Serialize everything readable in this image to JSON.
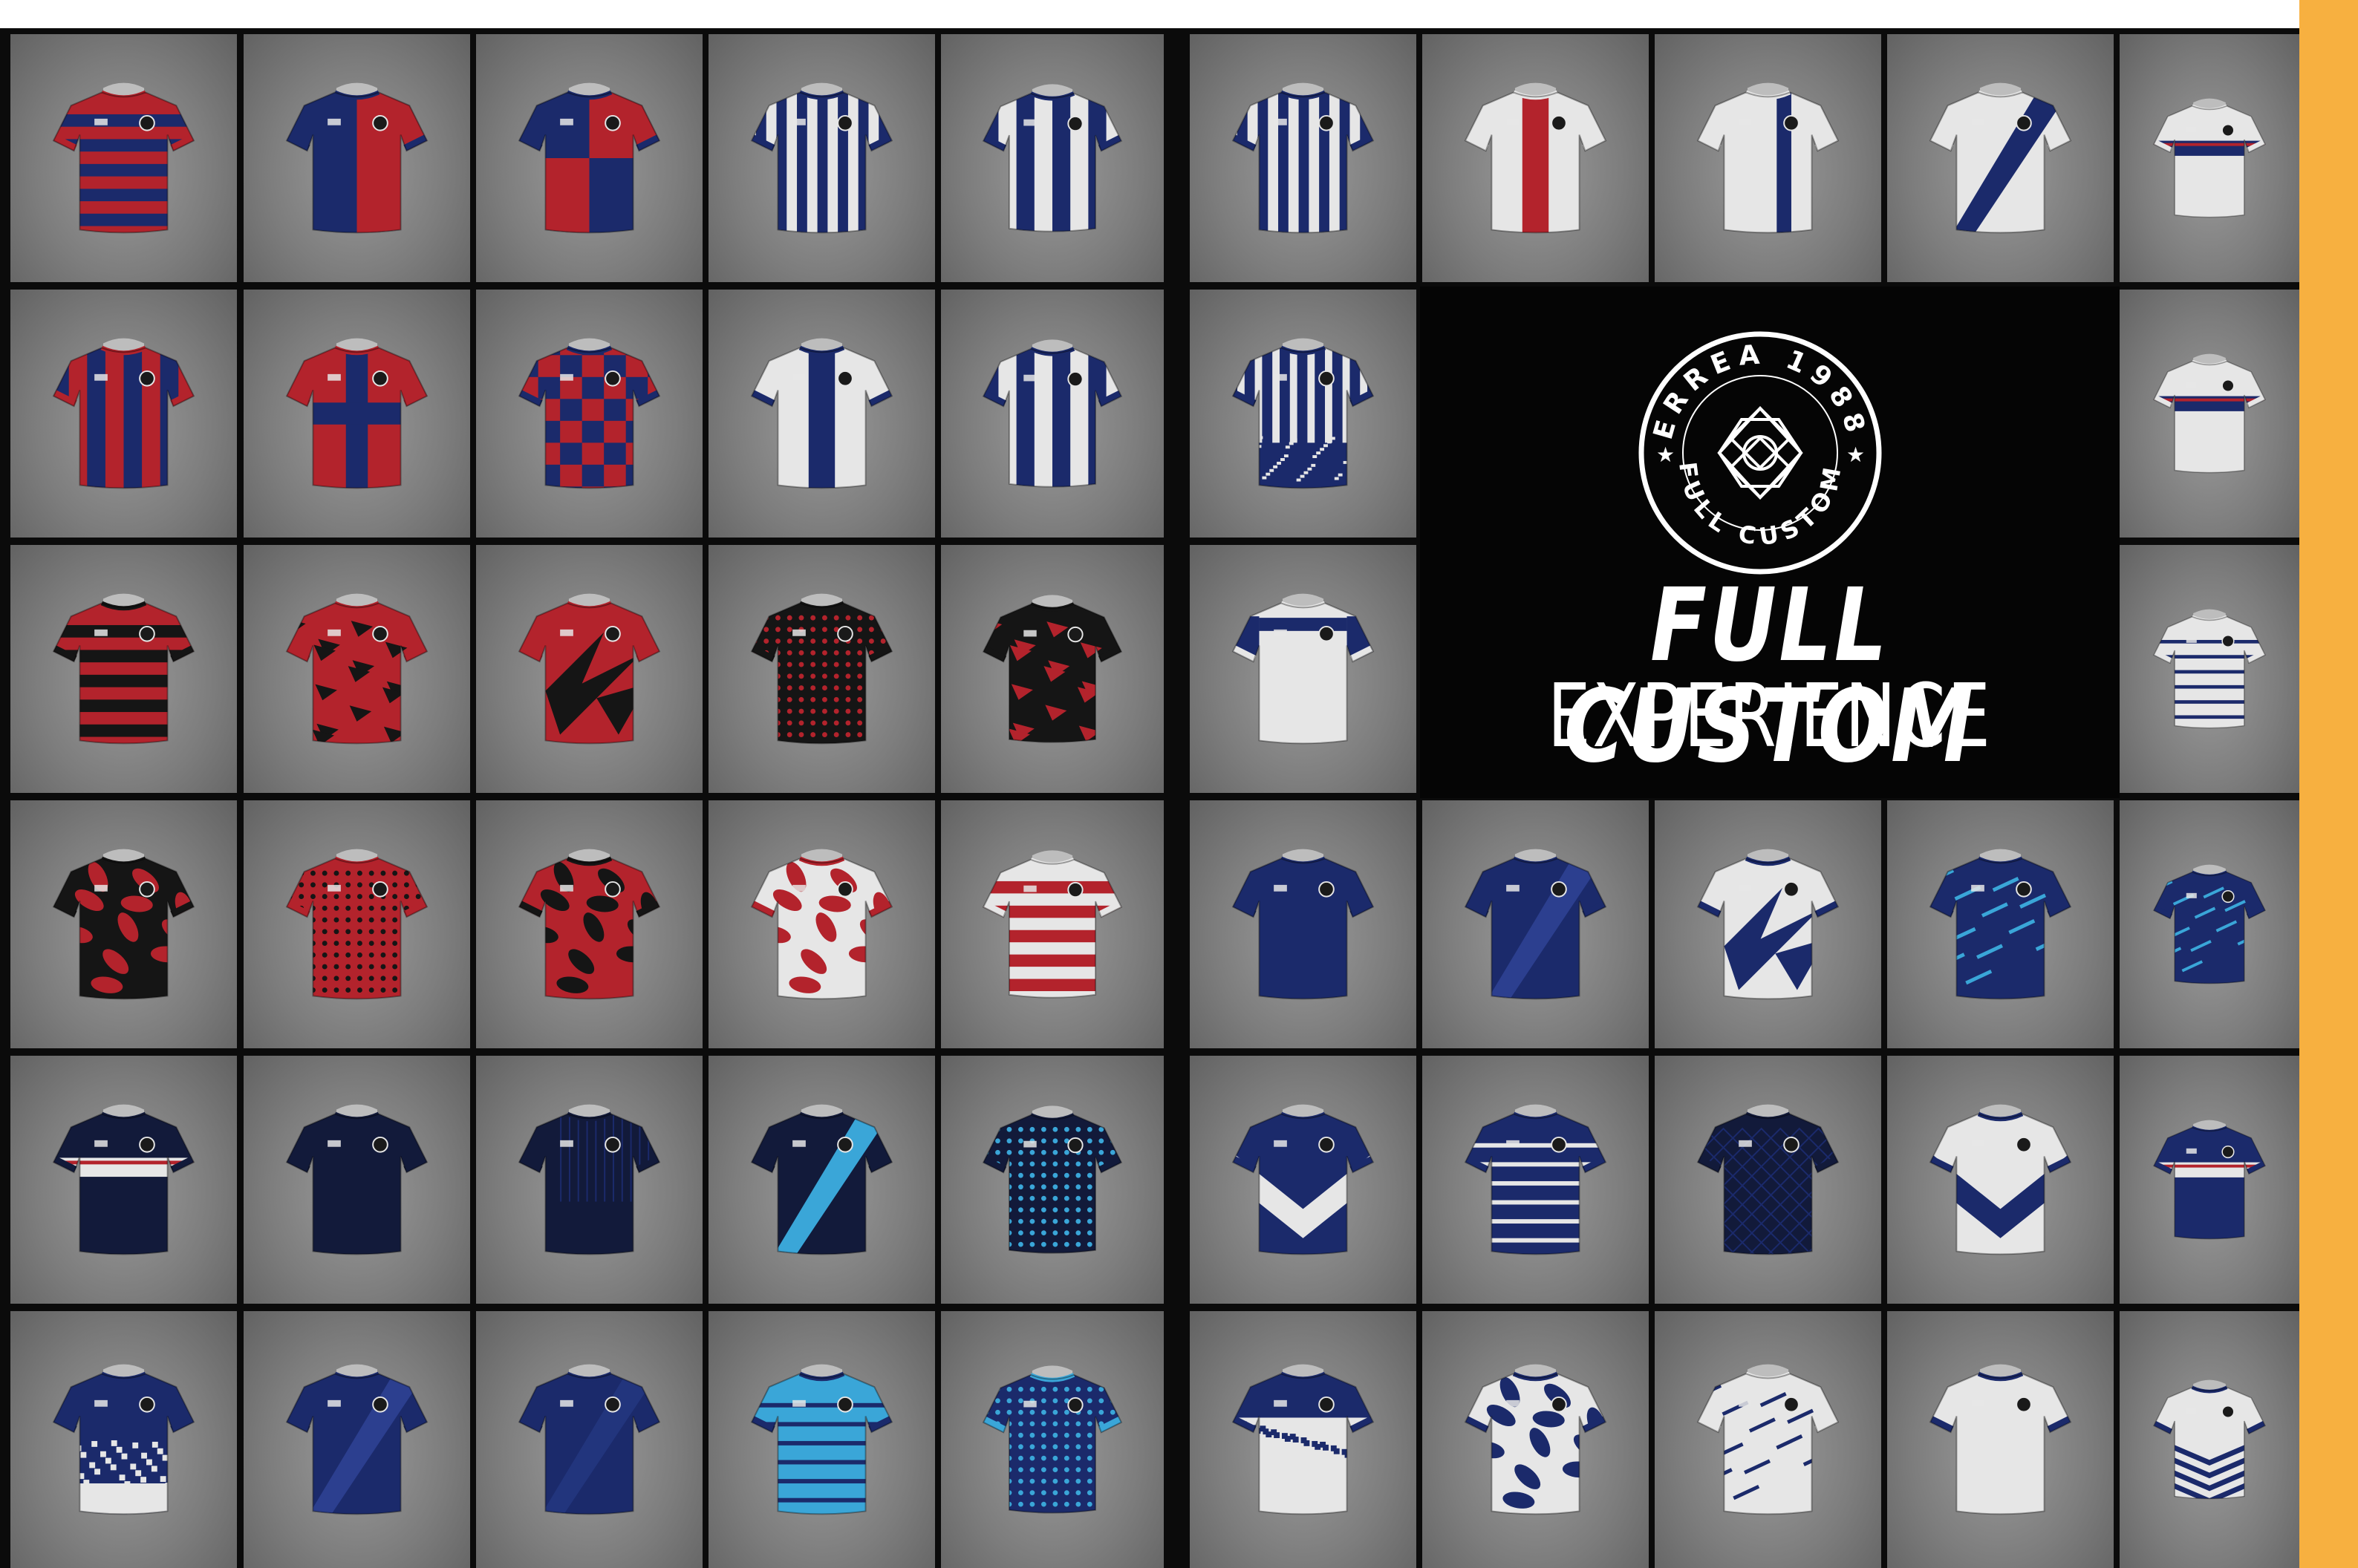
{
  "brand": {
    "seal_text_top": "ERREA 1988",
    "seal_text_bottom": "FULL CUSTOM",
    "headline": "FULL CUSTOM",
    "subheadline": "EXPERIENCE"
  },
  "colors": {
    "accent_bar": "#f7b040",
    "background": "#0b0b0b",
    "red": "#b3232c",
    "navy": "#1b2a6b",
    "white": "#e6e6e6",
    "black": "#151515",
    "cyan": "#3aa6d8"
  },
  "jerseys": [
    {
      "style": "hoops",
      "c1": "#b3232c",
      "c2": "#1b2a6b",
      "c3": "#b3232c"
    },
    {
      "style": "halves",
      "c1": "#1b2a6b",
      "c2": "#b3232c",
      "c3": "#1b2a6b"
    },
    {
      "style": "quarters",
      "c1": "#1b2a6b",
      "c2": "#b3232c",
      "c3": "#1b2a6b"
    },
    {
      "style": "vstripes",
      "c1": "#e6e6e6",
      "c2": "#1b2a6b",
      "c3": "#1b2a6b"
    },
    {
      "style": "vstripes-wide",
      "c1": "#e6e6e6",
      "c2": "#1b2a6b",
      "c3": "#1b2a6b"
    },
    {
      "style": "vstripes",
      "c1": "#e6e6e6",
      "c2": "#1b2a6b",
      "c3": "#1b2a6b"
    },
    {
      "style": "center-stripe",
      "c1": "#e6e6e6",
      "c2": "#b3232c",
      "c3": "#e6e6e6"
    },
    {
      "style": "offset-stripe",
      "c1": "#e6e6e6",
      "c2": "#1b2a6b",
      "c3": "#e6e6e6"
    },
    {
      "style": "sash",
      "c1": "#e6e6e6",
      "c2": "#1b2a6b",
      "c3": "#e6e6e6"
    },
    {
      "style": "chest-band",
      "c1": "#e6e6e6",
      "c2": "#1b2a6b",
      "c3": "#e6e6e6"
    },
    {
      "style": "vstripes-wide",
      "c1": "#b3232c",
      "c2": "#1b2a6b",
      "c3": "#b3232c"
    },
    {
      "style": "cross",
      "c1": "#b3232c",
      "c2": "#1b2a6b",
      "c3": "#b3232c"
    },
    {
      "style": "checks",
      "c1": "#1b2a6b",
      "c2": "#b3232c",
      "c3": "#1b2a6b"
    },
    {
      "style": "center-stripe",
      "c1": "#e6e6e6",
      "c2": "#1b2a6b",
      "c3": "#1b2a6b"
    },
    {
      "style": "vstripes-wide",
      "c1": "#e6e6e6",
      "c2": "#1b2a6b",
      "c3": "#1b2a6b"
    },
    {
      "style": "vstripes-fade",
      "c1": "#1b2a6b",
      "c2": "#e6e6e6",
      "c3": "#1b2a6b"
    },
    {
      "style": "chest-band",
      "c1": "#e6e6e6",
      "c2": "#1b2a6b",
      "c3": "#e6e6e6"
    },
    {
      "style": "hoops",
      "c1": "#b3232c",
      "c2": "#151515",
      "c3": "#151515"
    },
    {
      "style": "splatter",
      "c1": "#b3232c",
      "c2": "#151515",
      "c3": "#b3232c"
    },
    {
      "style": "shards",
      "c1": "#b3232c",
      "c2": "#151515",
      "c3": "#b3232c"
    },
    {
      "style": "dots",
      "c1": "#151515",
      "c2": "#b3232c",
      "c3": "#151515"
    },
    {
      "style": "brush",
      "c1": "#151515",
      "c2": "#b3232c",
      "c3": "#151515"
    },
    {
      "style": "rugby-panel",
      "c1": "#e6e6e6",
      "c2": "#1b2a6b",
      "c3": "#e6e6e6"
    },
    {
      "style": "thin-hoops",
      "c1": "#e6e6e6",
      "c2": "#1b2a6b",
      "c3": "#e6e6e6"
    },
    {
      "style": "camo",
      "c1": "#151515",
      "c2": "#b3232c",
      "c3": "#151515"
    },
    {
      "style": "dots",
      "c1": "#b3232c",
      "c2": "#151515",
      "c3": "#b3232c"
    },
    {
      "style": "camo",
      "c1": "#b3232c",
      "c2": "#151515",
      "c3": "#151515"
    },
    {
      "style": "camo-light",
      "c1": "#e6e6e6",
      "c2": "#b3232c",
      "c3": "#b3232c"
    },
    {
      "style": "hoops",
      "c1": "#e6e6e6",
      "c2": "#b3232c",
      "c3": "#e6e6e6"
    },
    {
      "style": "plain",
      "c1": "#1b2a6b",
      "c2": "#2c3f8f",
      "c3": "#1b2a6b"
    },
    {
      "style": "sash",
      "c1": "#1b2a6b",
      "c2": "#2c3f8f",
      "c3": "#1b2a6b"
    },
    {
      "style": "shards",
      "c1": "#e6e6e6",
      "c2": "#1b2a6b",
      "c3": "#1b2a6b"
    },
    {
      "style": "streaks",
      "c1": "#1b2a6b",
      "c2": "#3aa6d8",
      "c3": "#1b2a6b"
    },
    {
      "style": "streaks",
      "c1": "#1b2a6b",
      "c2": "#3aa6d8",
      "c3": "#1b2a6b"
    },
    {
      "style": "chest-band",
      "c1": "#121a3a",
      "c2": "#e6e6e6",
      "c3": "#121a3a"
    },
    {
      "style": "plain",
      "c1": "#121a3a",
      "c2": "#1b2a6b",
      "c3": "#121a3a"
    },
    {
      "style": "pinstripes",
      "c1": "#121a3a",
      "c2": "#1b2a6b",
      "c3": "#121a3a"
    },
    {
      "style": "sash",
      "c1": "#121a3a",
      "c2": "#3aa6d8",
      "c3": "#121a3a"
    },
    {
      "style": "dots",
      "c1": "#121a3a",
      "c2": "#3aa6d8",
      "c3": "#121a3a"
    },
    {
      "style": "chevron",
      "c1": "#1b2a6b",
      "c2": "#e6e6e6",
      "c3": "#1b2a6b"
    },
    {
      "style": "thin-hoops",
      "c1": "#1b2a6b",
      "c2": "#e6e6e6",
      "c3": "#1b2a6b"
    },
    {
      "style": "diamonds",
      "c1": "#121a3a",
      "c2": "#1b2a6b",
      "c3": "#121a3a"
    },
    {
      "style": "chevron",
      "c1": "#e6e6e6",
      "c2": "#1b2a6b",
      "c3": "#1b2a6b"
    },
    {
      "style": "chest-band",
      "c1": "#1b2a6b",
      "c2": "#e6e6e6",
      "c3": "#1b2a6b"
    },
    {
      "style": "fade",
      "c1": "#1b2a6b",
      "c2": "#e6e6e6",
      "c3": "#1b2a6b"
    },
    {
      "style": "sash",
      "c1": "#1b2a6b",
      "c2": "#2c3f8f",
      "c3": "#1b2a6b"
    },
    {
      "style": "sash",
      "c1": "#1b2a6b",
      "c2": "#22357d",
      "c3": "#1b2a6b"
    },
    {
      "style": "thin-hoops",
      "c1": "#3aa6d8",
      "c2": "#1b2a6b",
      "c3": "#1b2a6b"
    },
    {
      "style": "dots",
      "c1": "#1b2a6b",
      "c2": "#3aa6d8",
      "c3": "#3aa6d8"
    },
    {
      "style": "fade-rev",
      "c1": "#e6e6e6",
      "c2": "#1b2a6b",
      "c3": "#1b2a6b"
    },
    {
      "style": "camo-light",
      "c1": "#e6e6e6",
      "c2": "#1b2a6b",
      "c3": "#1b2a6b"
    },
    {
      "style": "streaks",
      "c1": "#e6e6e6",
      "c2": "#1b2a6b",
      "c3": "#e6e6e6"
    },
    {
      "style": "plain",
      "c1": "#e6e6e6",
      "c2": "#1b2a6b",
      "c3": "#1b2a6b"
    },
    {
      "style": "chevrons",
      "c1": "#e6e6e6",
      "c2": "#1b2a6b",
      "c3": "#1b2a6b"
    }
  ]
}
